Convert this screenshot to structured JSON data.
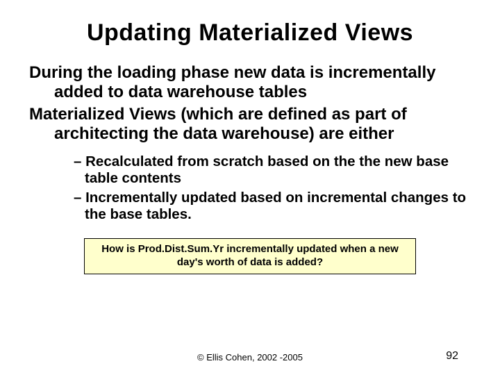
{
  "title": "Updating Materialized Views",
  "para1": "During the loading phase new data is incrementally added to data warehouse tables",
  "para2": "Materialized Views (which are defined as part of architecting the data warehouse) are either",
  "bullets": [
    "Recalculated from scratch based on the the new base table contents",
    "Incrementally updated based on incremental changes to the base tables."
  ],
  "callout": "How is Prod.Dist.Sum.Yr incrementally updated when a new day's worth of data is added?",
  "copyright": "© Ellis Cohen, 2002 -2005",
  "page": "92"
}
